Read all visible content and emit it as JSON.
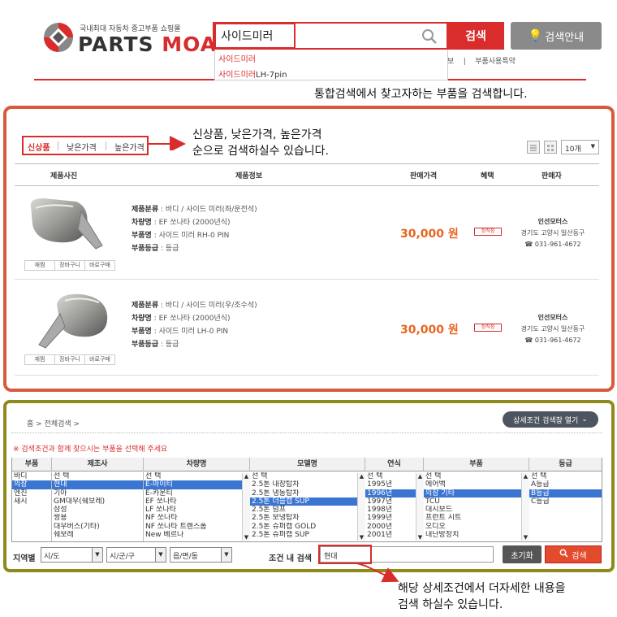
{
  "header": {
    "logo_tagline": "국내최대 자동차 중고부품 쇼핑몰",
    "logo_word_1": "PARTS",
    "logo_word_2": "MOA",
    "search_value": "사이드미러",
    "search_button": "검색",
    "guide_button": "검색안내",
    "suggestions": [
      {
        "highlight": "사이드미러",
        "rest": ""
      },
      {
        "highlight": "사이드미러",
        "rest": "LH-7pin"
      }
    ],
    "nav_fragment_1": "보",
    "nav_fragment_2": "부품사용특약",
    "annotation": "통합검색에서 찾고자하는 부품을 검색합니다."
  },
  "list": {
    "sort_options": [
      "신상품",
      "낮은가격",
      "높은가격"
    ],
    "active_sort": "신상품",
    "annotation_line1": "신상품, 낮은가격, 높은가격",
    "annotation_line2": "순으로 검색하실수 있습니다.",
    "count_select": "10개",
    "columns": [
      "제품사진",
      "제품정보",
      "판매가격",
      "혜택",
      "판매자"
    ],
    "thumb_actions": [
      "재찜",
      "장바구니",
      "바로구매"
    ],
    "products": [
      {
        "category_label": "제품분류",
        "category": "바디 / 사이드 미러(좌/운전석)",
        "vehicle_label": "차량명",
        "vehicle": "EF 쏘나타 (2000년식)",
        "part_label": "부품명",
        "part": "사이드 미러 RH-0 PIN",
        "grade_label": "부품등급",
        "grade": "등급",
        "price": "30,000 원",
        "benefit": "정직점",
        "seller_name": "인선모터스",
        "seller_addr": "경기도 고양시 일산동구",
        "seller_phone": "031-961-4672"
      },
      {
        "category_label": "제품분류",
        "category": "바디 / 사이드 미러(우/조수석)",
        "vehicle_label": "차량명",
        "vehicle": "EF 쏘나타 (2000년식)",
        "part_label": "부품명",
        "part": "사이드 미러 LH-0 PIN",
        "grade_label": "부품등급",
        "grade": "등급",
        "price": "30,000 원",
        "benefit": "정직점",
        "seller_name": "인선모터스",
        "seller_addr": "경기도 고양시 일산동구",
        "seller_phone": "031-961-4672"
      }
    ]
  },
  "detail": {
    "breadcrumb": "홈 > 전체검색 >",
    "toggle_button": "상세조건 검색창 열기",
    "notice": "※ 검색조건과 함께 찾으시는 부품을 선택해 주세요",
    "headers": [
      "부품",
      "제조사",
      "차량명",
      "모델명",
      "연식",
      "부품",
      "등급"
    ],
    "col_part": [
      "바디",
      "의장",
      "엔진",
      "새시"
    ],
    "col_maker": [
      "선 택",
      "현대",
      "기아",
      "GM대우(쉐보레)",
      "삼성",
      "쌍용",
      "대우버스(기타)",
      "쉐보레"
    ],
    "col_car": [
      "선 택",
      "E-마이티",
      "E-카운티",
      "EF 쏘나타",
      "LF 쏘나타",
      "NF 쏘나타",
      "NF 쏘나타 트랜스폼",
      "New 베르나"
    ],
    "col_model": [
      "선 택",
      "2.5톤 내장탑차",
      "2.5톤 냉동탑차",
      "2.5톤 더블캡 SUP",
      "2.5톤 덤프",
      "2.5톤 보냉탑차",
      "2.5톤 슈퍼캡 GOLD",
      "2.5톤 슈퍼캡 SUP"
    ],
    "col_year": [
      "선 택",
      "1995년",
      "1996년",
      "1997년",
      "1998년",
      "1999년",
      "2000년",
      "2001년"
    ],
    "col_part2": [
      "선 택",
      "에어백",
      "의장 기타",
      "TCU",
      "대시보드",
      "프런트 시트",
      "오디오",
      "내난방장치"
    ],
    "col_grade": [
      "선 택",
      "A등급",
      "B등급",
      "C등급"
    ],
    "region_label": "지역별",
    "region_selects": [
      "시/도",
      "시/군/구",
      "읍/면/동"
    ],
    "cond_label": "조건 내 검색",
    "cond_value": "현대",
    "reset_button": "초기화",
    "search_button": "검색",
    "annotation_line1": "해당 상세조건에서 더자세한 내용을",
    "annotation_line2": "검색 하실수 있습니다."
  },
  "colors": {
    "accent": "#d92c2c",
    "price": "#e8651f",
    "panel1_border": "#d85a3c",
    "panel2_border": "#8e8a1c",
    "selection": "#3a75d1"
  }
}
